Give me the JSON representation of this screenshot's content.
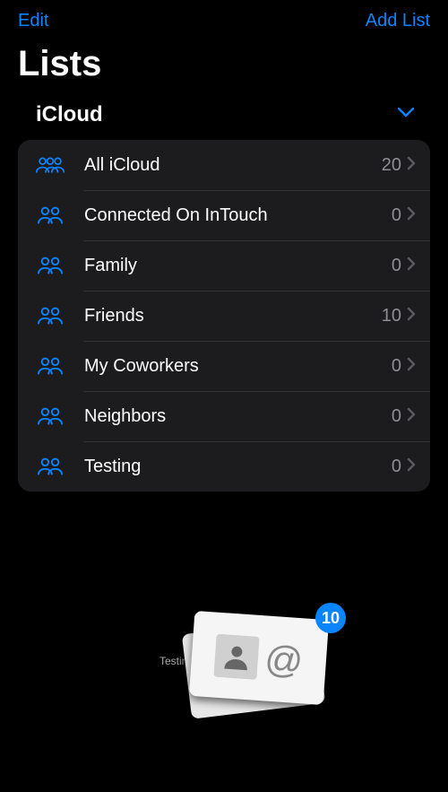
{
  "nav": {
    "left": "Edit",
    "right": "Add List"
  },
  "title": "Lists",
  "section": {
    "name": "iCloud"
  },
  "rows": [
    {
      "label": "All iCloud",
      "count": "20",
      "iconCount": 3
    },
    {
      "label": "Connected On InTouch",
      "count": "0",
      "iconCount": 2
    },
    {
      "label": "Family",
      "count": "0",
      "iconCount": 2
    },
    {
      "label": "Friends",
      "count": "10",
      "iconCount": 2
    },
    {
      "label": "My Coworkers",
      "count": "0",
      "iconCount": 2
    },
    {
      "label": "Neighbors",
      "count": "0",
      "iconCount": 2
    },
    {
      "label": "Testing",
      "count": "0",
      "iconCount": 2
    }
  ],
  "drag": {
    "label": "Testing",
    "badge": "10"
  }
}
